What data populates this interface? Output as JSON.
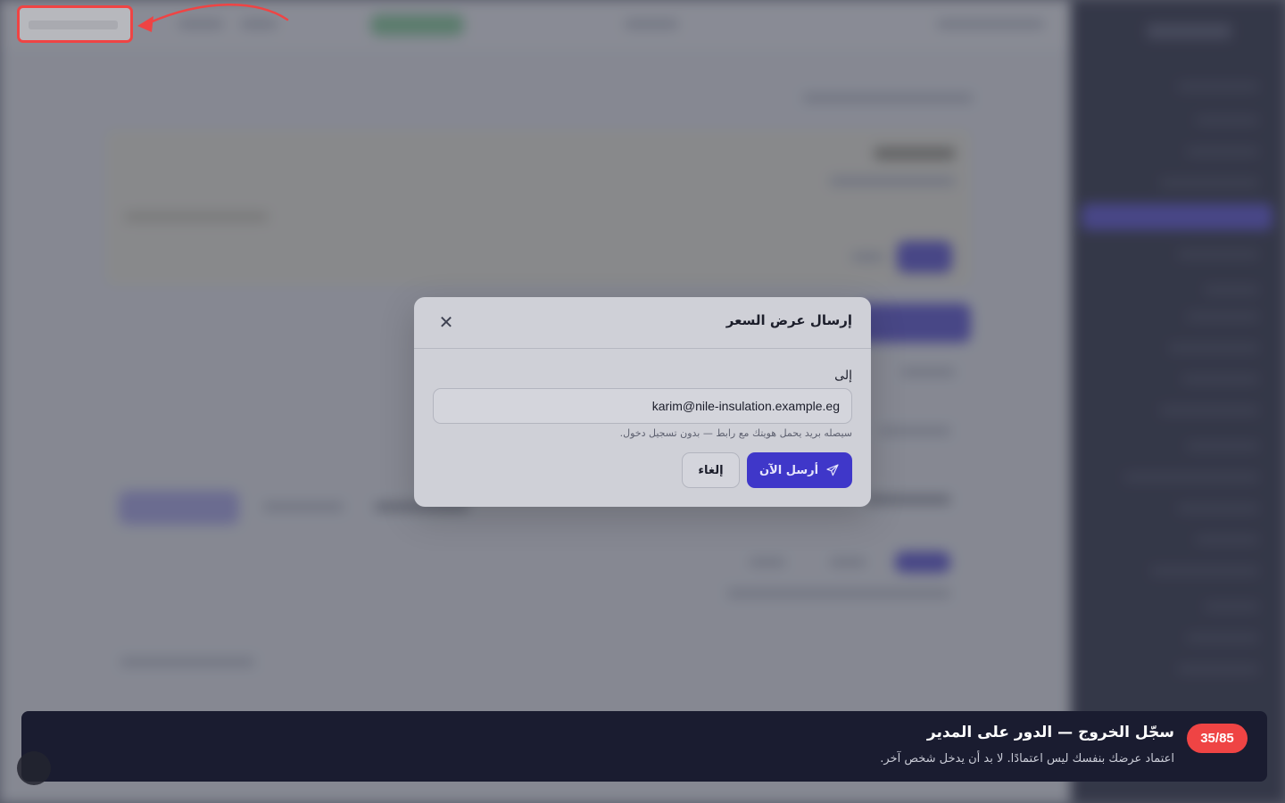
{
  "modal": {
    "title": "إرسال عرض السعر",
    "to_label": "إلى",
    "to_value": "karim@nile-insulation.example.eg",
    "hint": "سيصله بريد يحمل هويتك مع رابط — بدون تسجيل دخول.",
    "send_label": "أرسل الآن",
    "cancel_label": "إلغاء",
    "close_icon": "close-icon",
    "send_icon": "paper-plane-icon"
  },
  "tour": {
    "step": "35/85",
    "title": "سجّل الخروج — الدور على المدير",
    "subtitle": "اعتماد عرضك بنفسك ليس اعتمادًا. لا بد أن يدخل شخص آخر."
  },
  "colors": {
    "accent": "#3f37c9",
    "highlight": "#ef4444",
    "tour_bg": "#1a1c30"
  }
}
